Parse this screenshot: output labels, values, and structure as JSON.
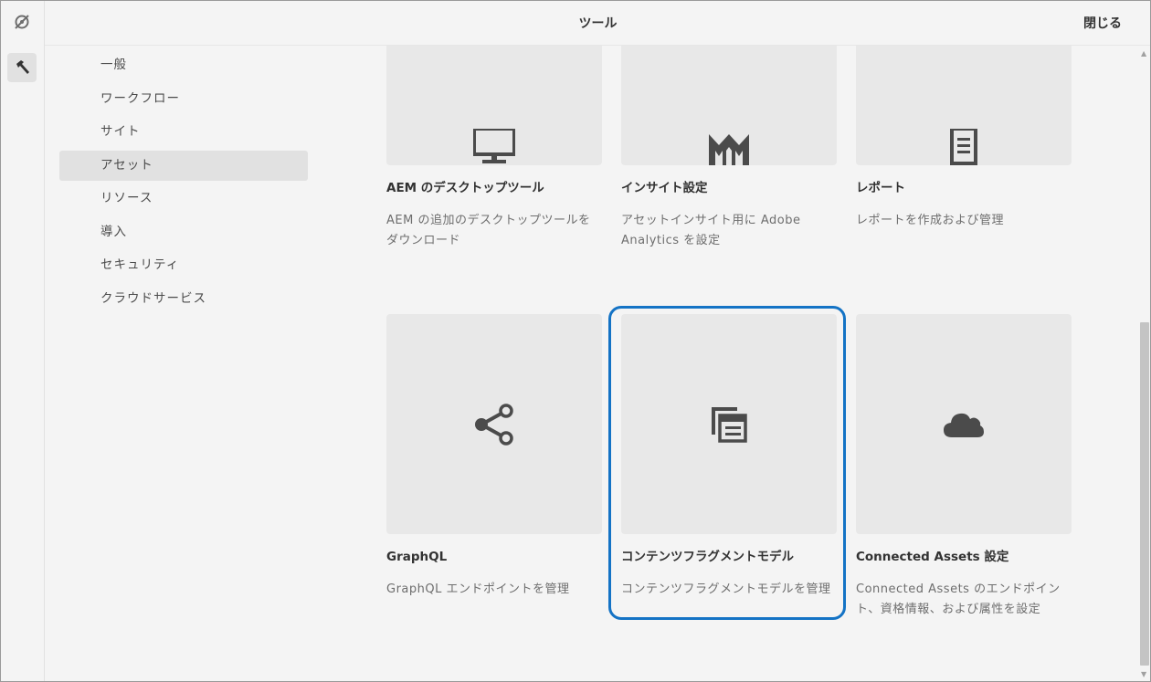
{
  "header": {
    "title": "ツール",
    "close_label": "閉じる"
  },
  "rail": {
    "icons": [
      "no-eye-icon",
      "hammer-icon"
    ]
  },
  "nav": {
    "items": [
      {
        "label": "一般"
      },
      {
        "label": "ワークフロー"
      },
      {
        "label": "サイト"
      },
      {
        "label": "アセット",
        "selected": true
      },
      {
        "label": "リソース"
      },
      {
        "label": "導入"
      },
      {
        "label": "セキュリティ"
      },
      {
        "label": "クラウドサービス"
      }
    ]
  },
  "cards": [
    {
      "icon": "monitor-icon",
      "title": "AEM のデスクトップツール",
      "desc": "AEM の追加のデスクトップツールをダウンロード"
    },
    {
      "icon": "insights-icon",
      "title": "インサイト設定",
      "desc": "アセットインサイト用に Adobe Analytics を設定"
    },
    {
      "icon": "report-icon",
      "title": "レポート",
      "desc": "レポートを作成および管理"
    },
    {
      "icon": "share-icon",
      "title": "GraphQL",
      "desc": "GraphQL エンドポイントを管理"
    },
    {
      "icon": "fragment-model-icon",
      "title": "コンテンツフラグメントモデル",
      "desc": "コンテンツフラグメントモデルを管理",
      "focused": true
    },
    {
      "icon": "cloud-icon",
      "title": "Connected Assets 設定",
      "desc": "Connected Assets のエンドポイント、資格情報、および属性を設定"
    }
  ],
  "colors": {
    "accent": "#1473c5",
    "background": "#f4f4f4",
    "tile": "#e8e8e8",
    "selected": "#e1e1e1"
  }
}
